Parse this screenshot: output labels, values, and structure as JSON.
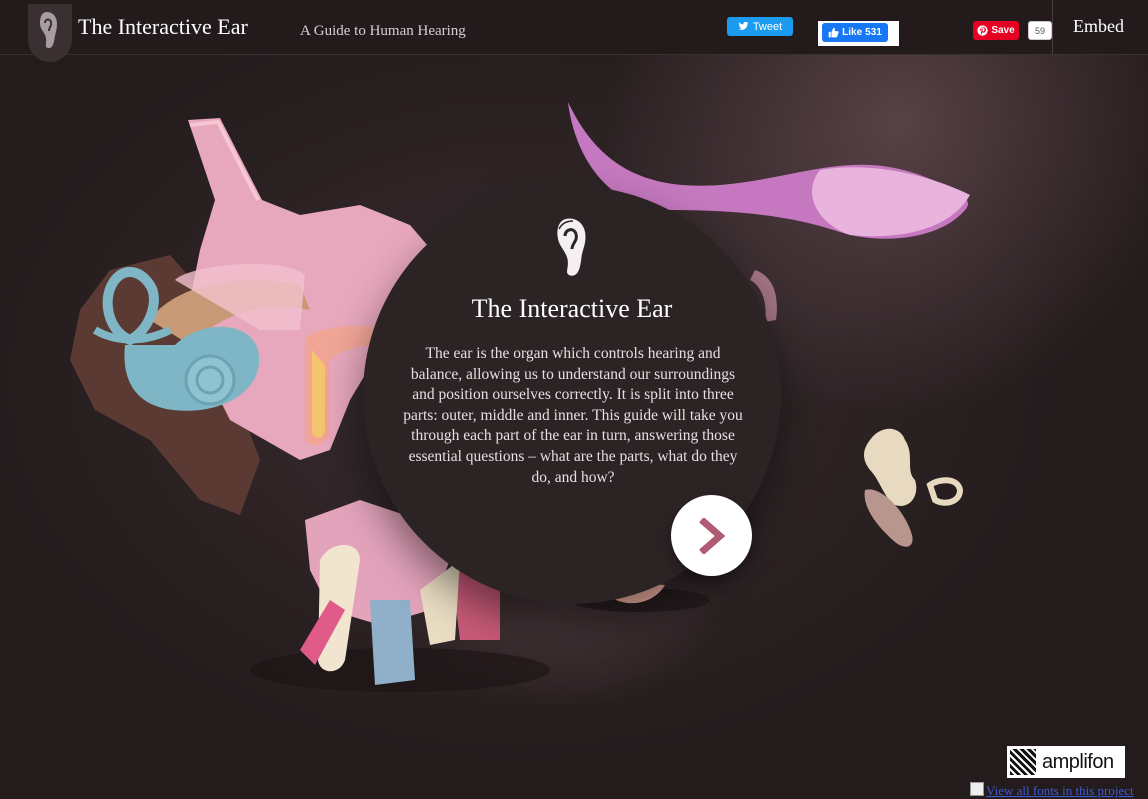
{
  "header": {
    "title": "The Interactive Ear",
    "subtitle": "A Guide to Human Hearing",
    "logo_icon": "ear-icon"
  },
  "social": {
    "tweet_label": "Tweet",
    "like_label": "Like",
    "like_count": "531",
    "save_label": "Save",
    "save_count": "59",
    "colors": {
      "twitter": "#1d9bf0",
      "facebook": "#1877f2",
      "pinterest": "#e60023"
    }
  },
  "embed": {
    "label": "Embed"
  },
  "intro": {
    "icon": "ear-icon",
    "title": "The Interactive Ear",
    "body": "The ear is the organ which controls hearing and balance, allowing us to understand our surroundings and position ourselves correctly. It is split into three parts: outer, middle and inner. This guide will take you through each part of the ear in turn, answering those essential questions – what are the parts, what do they do, and how?",
    "next_icon": "chevron-right-icon",
    "accent": "#b05a73"
  },
  "footer": {
    "brand_name": "amplifon",
    "fonts_link_alt": "View all fonts in this project"
  },
  "illustration": {
    "parts": [
      "outer-ear-cartilage",
      "auditory-canal",
      "cochlea",
      "semicircular-canals",
      "eustachian-tube",
      "ossicles",
      "eardrum"
    ]
  }
}
